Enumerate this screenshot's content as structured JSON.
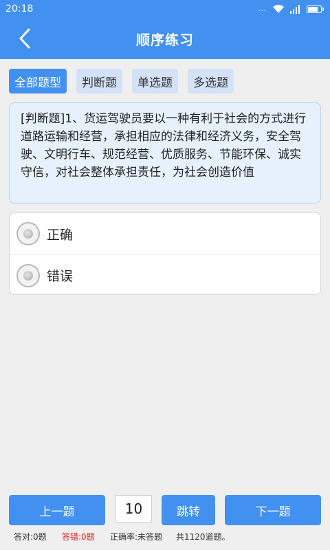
{
  "status_bar": {
    "time": "20:18",
    "dots": "...",
    "colors": {
      "bar": "#4290f0"
    }
  },
  "header": {
    "title": "顺序练习",
    "back_icon": "chevron-left-icon"
  },
  "tabs": [
    {
      "label": "全部题型",
      "active": true
    },
    {
      "label": "判断题",
      "active": false
    },
    {
      "label": "单选题",
      "active": false
    },
    {
      "label": "多选题",
      "active": false
    }
  ],
  "question": {
    "text": "[判断题]1、货运驾驶员要以一种有利于社会的方式进行道路运输和经营，承担相应的法律和经济义务，安全驾驶、文明行车、规范经营、优质服务、节能环保、诚实守信，对社会整体承担责任，为社会创造价值"
  },
  "options": [
    {
      "label": "正确",
      "selected": false
    },
    {
      "label": "错误",
      "selected": false
    }
  ],
  "navigation": {
    "prev_label": "上一题",
    "page_value": "10",
    "jump_label": "跳转",
    "next_label": "下一题"
  },
  "stats": {
    "correct": "答对:0题",
    "wrong": "答错:0题",
    "rate": "正确率:未答题",
    "total": "共1120道题。"
  },
  "colors": {
    "accent": "#4290f0",
    "tab_inactive": "#d4e2f8",
    "question_bg": "#e6f1fd",
    "wrong_text": "#e02020"
  }
}
